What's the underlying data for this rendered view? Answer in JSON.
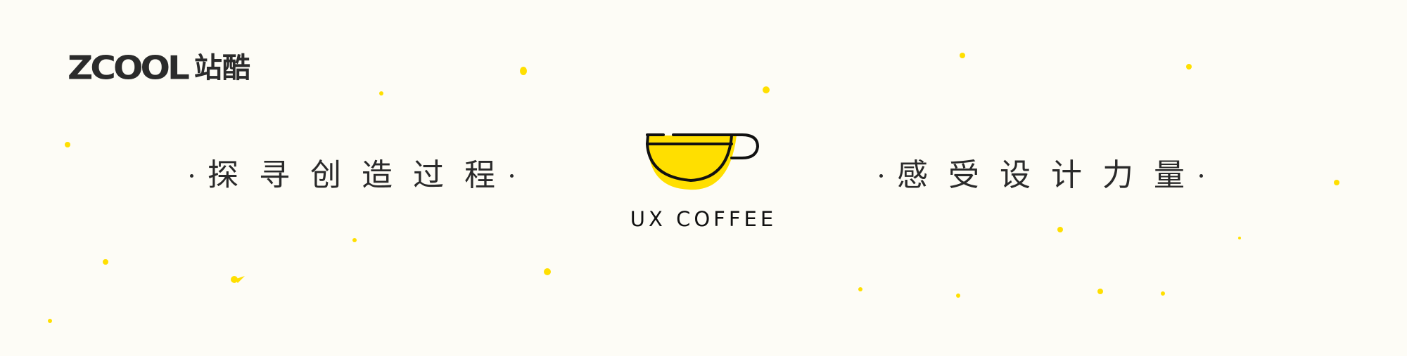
{
  "logo": {
    "latin": "ZCOOL",
    "cjk": "站酷"
  },
  "slogan_left": "探寻创造过程",
  "slogan_right": "感受设计力量",
  "brand_name": "UX COFFEE",
  "colors": {
    "background": "#fdfcf6",
    "accent_yellow": "#ffdf00",
    "ink": "#111111"
  },
  "icons": [
    "coffee-cup-icon"
  ]
}
